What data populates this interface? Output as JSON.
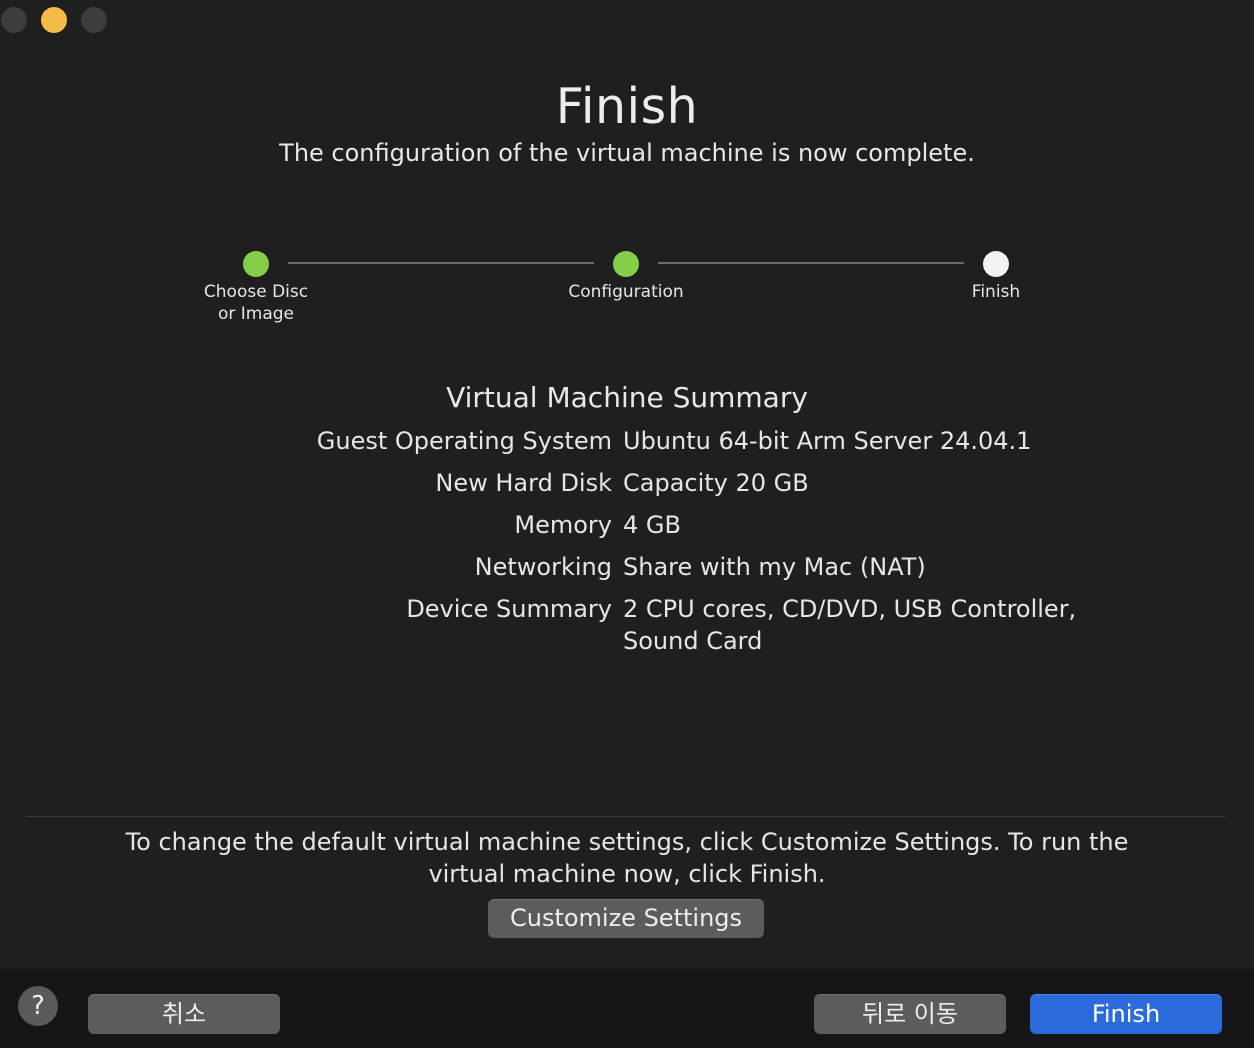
{
  "window": {
    "controls": [
      "close",
      "minimize",
      "zoom"
    ]
  },
  "header": {
    "title": "Finish",
    "subtitle": "The configuration of the virtual machine is now complete."
  },
  "steps": [
    {
      "label_line1": "Choose Disc",
      "label_line2": "or Image",
      "state": "done",
      "color": "#84cf47"
    },
    {
      "label_line1": "Configuration",
      "label_line2": "",
      "state": "done",
      "color": "#84cf47"
    },
    {
      "label_line1": "Finish",
      "label_line2": "",
      "state": "current",
      "color": "#f2f2f2"
    }
  ],
  "summary": {
    "title": "Virtual Machine Summary",
    "rows": [
      {
        "key": "Guest Operating System",
        "value": "Ubuntu 64-bit Arm Server 24.04.1"
      },
      {
        "key": "New Hard Disk",
        "value": "Capacity 20 GB"
      },
      {
        "key": "Memory",
        "value": "4 GB"
      },
      {
        "key": "Networking",
        "value": "Share with my Mac (NAT)"
      },
      {
        "key": "Device Summary",
        "value": "2 CPU cores, CD/DVD, USB Controller, Sound Card"
      }
    ]
  },
  "hint": {
    "text": "To change the default virtual machine settings, click Customize Settings. To run the virtual machine now, click Finish."
  },
  "buttons": {
    "customize": "Customize Settings",
    "help": "?",
    "cancel": "취소",
    "back": "뒤로 이동",
    "finish": "Finish"
  },
  "colors": {
    "background": "#1f1f1f",
    "step_done": "#84cf47",
    "step_current": "#f2f2f2",
    "primary_button": "#2c6bdc",
    "minimize_light": "#f3bc46"
  }
}
